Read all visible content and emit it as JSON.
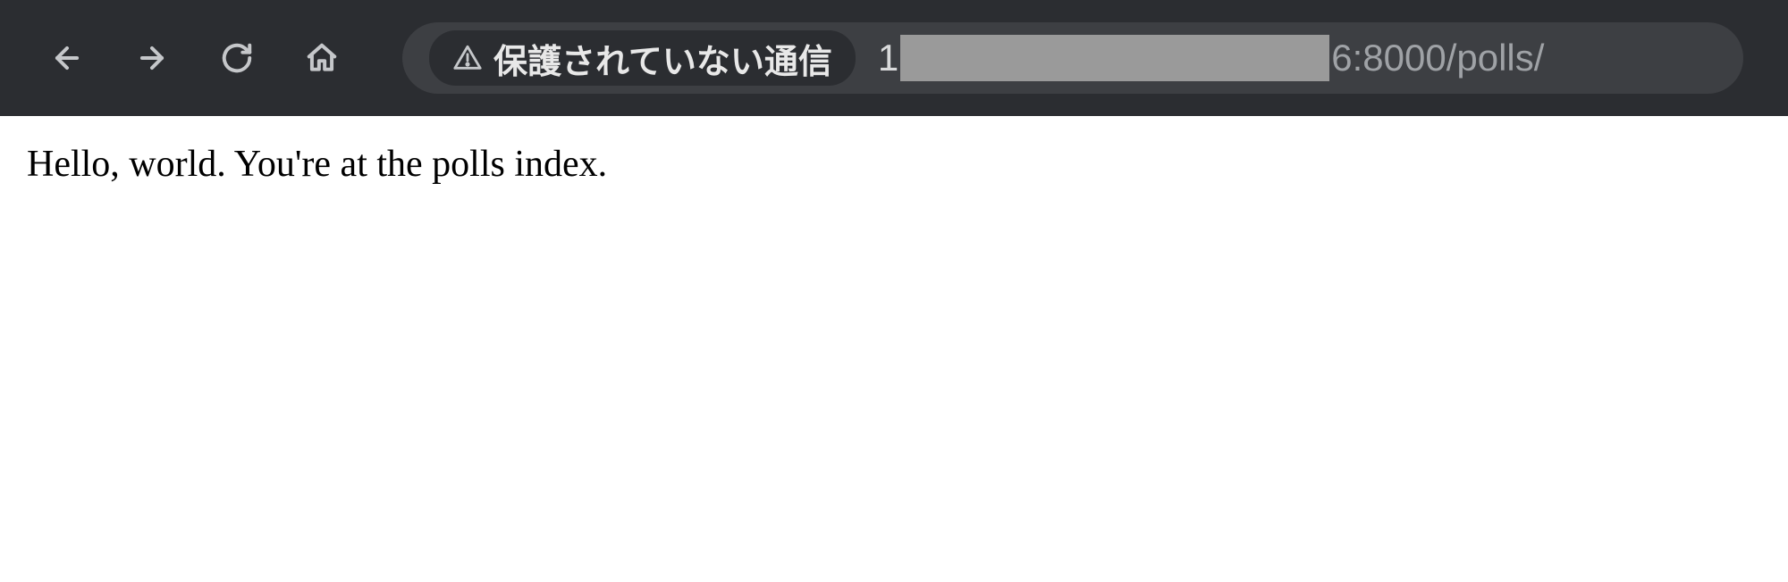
{
  "toolbar": {
    "back_icon": "back-icon",
    "forward_icon": "forward-icon",
    "reload_icon": "reload-icon",
    "home_icon": "home-icon"
  },
  "address": {
    "security_label": "保護されていない通信",
    "url_prefix": "1",
    "url_port_path": "6:8000/polls/"
  },
  "page": {
    "body_text": "Hello, world. You're at the polls index."
  }
}
